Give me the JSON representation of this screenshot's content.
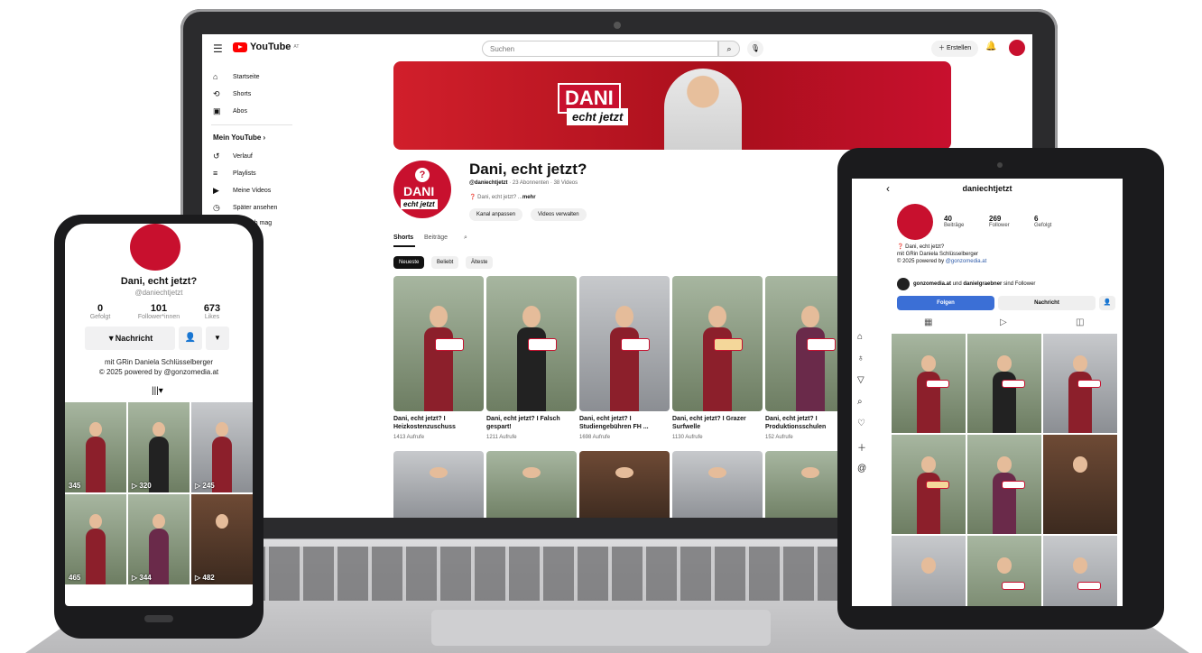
{
  "youtube": {
    "logo": "YouTube",
    "logo_sup": "AT",
    "search_placeholder": "Suchen",
    "create_label": "Erstellen",
    "sidebar": [
      {
        "icon": "⌂",
        "label": "Startseite"
      },
      {
        "icon": "⟲",
        "label": "Shorts"
      },
      {
        "icon": "▣",
        "label": "Abos"
      }
    ],
    "sidebar_section": "Mein YouTube  ›",
    "sidebar_you": [
      {
        "icon": "↺",
        "label": "Verlauf"
      },
      {
        "icon": "≡",
        "label": "Playlists"
      },
      {
        "icon": "▶",
        "label": "Meine Videos"
      },
      {
        "icon": "◷",
        "label": "Später ansehen"
      },
      {
        "icon": "",
        "label": "s, die ich mag"
      }
    ],
    "channel": {
      "name": "Dani, echt jetzt?",
      "handle": "@daniechtjetzt",
      "meta": " · 23 Abonnenten · 38 Videos",
      "desc": "Dani, echt jetzt? ...",
      "desc_more": "mehr",
      "customize": "Kanal anpassen",
      "manage": "Videos verwalten"
    },
    "banner": {
      "dani": "DANI",
      "echt": "echt jetzt"
    },
    "tabs": [
      "Shorts",
      "Beiträge"
    ],
    "chips": [
      "Neueste",
      "Beliebt",
      "Älteste"
    ],
    "shorts": [
      {
        "title": "Dani, echt jetzt? I Heizkostenzuschuss",
        "views": "1413 Aufrufe"
      },
      {
        "title": "Dani, echt jetzt? I Falsch gespart!",
        "views": "1211 Aufrufe"
      },
      {
        "title": "Dani, echt jetzt? I Studiengebühren FH ...",
        "views": "1698 Aufrufe"
      },
      {
        "title": "Dani, echt jetzt? I Grazer Surfwelle",
        "views": "1130 Aufrufe"
      },
      {
        "title": "Dani, echt jetzt? I Produktionsschulen",
        "views": "152 Aufrufe"
      }
    ]
  },
  "tiktok": {
    "name": "Dani, echt jetzt?",
    "handle": "@daniechtjetzt",
    "stats": [
      {
        "n": "0",
        "l": "Gefolgt"
      },
      {
        "n": "101",
        "l": "Follower*innen"
      },
      {
        "n": "673",
        "l": "Likes"
      }
    ],
    "message": "Nachricht",
    "bio1": "mit GRin Daniela Schlüsselberger",
    "bio2": "© 2025 powered by @gonzomedia.at",
    "counts": [
      "345",
      "320",
      "245",
      "465",
      "344",
      "482"
    ]
  },
  "instagram": {
    "username": "daniechtjetzt",
    "stats": [
      {
        "n": "40",
        "l": "Beiträge"
      },
      {
        "n": "269",
        "l": "Follower"
      },
      {
        "n": "6",
        "l": "Gefolgt"
      }
    ],
    "bio1": "Dani, echt jetzt?",
    "bio2": "mit GRin Daniela Schlüsselberger",
    "bio3a": "© 2025 powered by ",
    "bio3b": "@gonzomedia.at",
    "followed_by_a": "gonzomedia.at",
    "followed_by_mid": " und ",
    "followed_by_b": "danielgraebner",
    "followed_by_end": " sind Follower",
    "follow": "Folgen",
    "message": "Nachricht"
  },
  "colors": {
    "brand_red": "#c8102e",
    "ig_blue": "#3b6fd6",
    "yt_red": "#ff0000"
  }
}
